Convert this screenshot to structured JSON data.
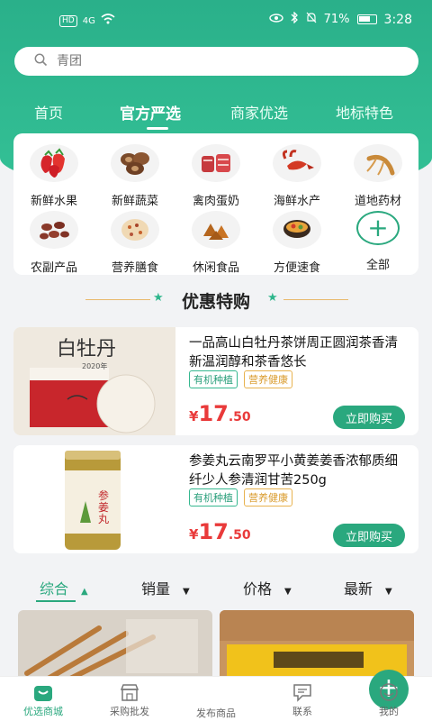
{
  "status": {
    "signal": "4G",
    "hd": "HD",
    "battery": "71%",
    "time": "3:28"
  },
  "search": {
    "placeholder": "青团"
  },
  "tabs": [
    "首页",
    "官方严选",
    "商家优选",
    "地标特色"
  ],
  "categories": [
    {
      "label": "新鲜水果",
      "icon": "strawberry-icon"
    },
    {
      "label": "新鲜蔬菜",
      "icon": "mushroom-icon"
    },
    {
      "label": "禽肉蛋奶",
      "icon": "meat-icon"
    },
    {
      "label": "海鲜水产",
      "icon": "lobster-icon"
    },
    {
      "label": "道地药材",
      "icon": "ginseng-icon"
    },
    {
      "label": "农副产品",
      "icon": "beans-icon"
    },
    {
      "label": "营养膳食",
      "icon": "porridge-icon"
    },
    {
      "label": "休闲食品",
      "icon": "snack-icon"
    },
    {
      "label": "方便速食",
      "icon": "noodles-icon"
    },
    {
      "label": "全部",
      "icon": "plus-icon"
    }
  ],
  "section": {
    "title": "优惠特购"
  },
  "products": [
    {
      "title": "一品高山白牡丹茶饼周正圆润茶香清新温润醇和茶香悠长",
      "tags": [
        "有机种植",
        "营养健康"
      ],
      "currency": "¥",
      "price_int": "17",
      "price_dec": ".50",
      "buy_label": "立即购买",
      "image_text": "白牡丹",
      "image_sub": "2020年"
    },
    {
      "title": "参姜丸云南罗平小黄姜姜香浓郁质细纤少人参清润甘苦250g",
      "tags": [
        "有机种植",
        "营养健康"
      ],
      "currency": "¥",
      "price_int": "17",
      "price_dec": ".50",
      "buy_label": "立即购买",
      "image_text": "参姜丸"
    }
  ],
  "sort": [
    "综合",
    "销量",
    "价格",
    "最新"
  ],
  "tabbar": [
    "优选商城",
    "采购批发",
    "发布商品",
    "联系",
    "我的"
  ],
  "colors": {
    "primary": "#2aa87e",
    "price": "#e93a3a",
    "tag_gold": "#e8b24f"
  }
}
